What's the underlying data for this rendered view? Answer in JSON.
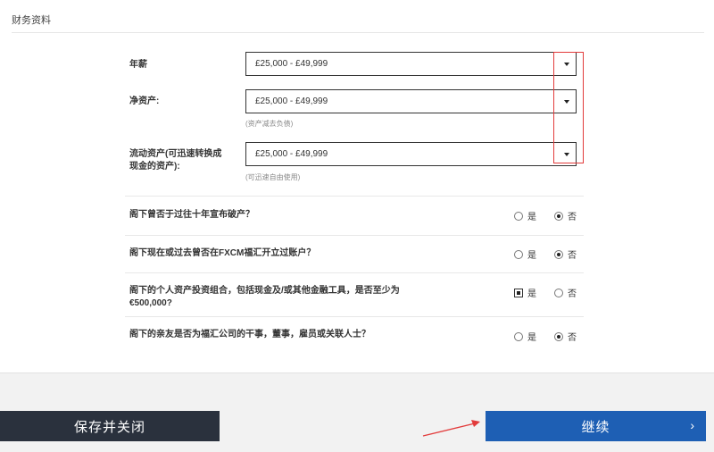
{
  "section": {
    "title": "财务资料"
  },
  "fields": [
    {
      "label": "年薪",
      "value": "£25,000 - £49,999",
      "hint": ""
    },
    {
      "label": "净资产:",
      "value": "£25,000 - £49,999",
      "hint": "(资产减去负债)"
    },
    {
      "label_line1": "流动资产(可迅速转换成",
      "label_line2": "现金的资产):",
      "value": "£25,000 - £49,999",
      "hint": "(可迅速自由使用)"
    }
  ],
  "questions": [
    {
      "text": "阁下曾否于过往十年宣布破产？",
      "yes": "是",
      "no": "否",
      "selected": "no"
    },
    {
      "text": "阁下现在或过去曾否在FXCM福汇开立过账户？",
      "yes": "是",
      "no": "否",
      "selected": "no"
    },
    {
      "text_line1": "阁下的个人资产投资组合，包括现金及/或其他金融工具，是否至少为",
      "text_line2": "€500,000?",
      "yes": "是",
      "no": "否",
      "selected": "yes"
    },
    {
      "text": "阁下的亲友是否为福汇公司的干事，董事，雇员或关联人士？",
      "yes": "是",
      "no": "否",
      "selected": "no"
    }
  ],
  "buttons": {
    "save_close": "保存并关闭",
    "continue": "继续",
    "continue_icon": "chevron-right-icon"
  },
  "colors": {
    "save_bg": "#2a313d",
    "continue_bg": "#1e5fb4",
    "highlight": "#e23b3b"
  }
}
